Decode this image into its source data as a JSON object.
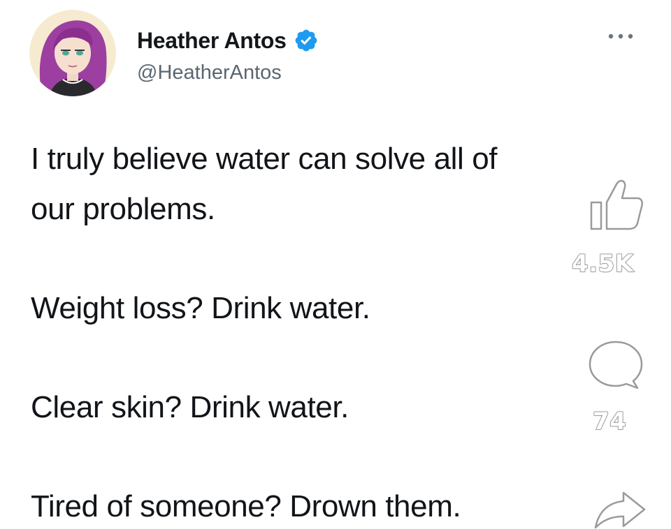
{
  "tweet": {
    "author": {
      "display_name": "Heather Antos",
      "handle": "@HeatherAntos",
      "verified": true,
      "avatar_icon": "avatar-illustration-purple-hair"
    },
    "more_icon": "more-horizontal-icon",
    "lines": [
      "I truly believe water can solve all of",
      "our problems.",
      "Weight loss? Drink water.",
      "Clear skin? Drink water.",
      "Tired of someone? Drown them."
    ]
  },
  "overlay": {
    "like": {
      "icon": "thumbs-up-icon",
      "count": "4.5K"
    },
    "comment": {
      "icon": "comment-bubble-icon",
      "count": "74"
    },
    "share": {
      "icon": "share-arrow-icon"
    }
  },
  "colors": {
    "verified_blue": "#1d9bf0",
    "text": "#14171a",
    "handle": "#5b6670",
    "hair": "#9c3fa0"
  }
}
